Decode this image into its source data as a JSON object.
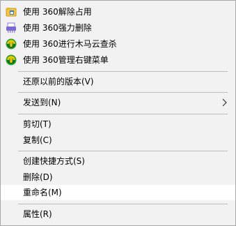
{
  "context_menu": {
    "items": [
      {
        "label": "使用 360解除占用",
        "icon": "folder-unlock-icon"
      },
      {
        "label": "使用 360强力删除",
        "icon": "shredder-icon"
      },
      {
        "label": "使用 360进行木马云查杀",
        "icon": "360-security-icon"
      },
      {
        "label": "使用 360管理右键菜单",
        "icon": "360-security-icon"
      },
      {
        "label": "还原以前的版本(V)"
      },
      {
        "label": "发送到(N)",
        "icon": "chevron-right-icon"
      },
      {
        "label": "剪切(T)"
      },
      {
        "label": "复制(C)"
      },
      {
        "label": "创建快捷方式(S)"
      },
      {
        "label": "删除(D)"
      },
      {
        "label": "重命名(M)",
        "state": "highlighted"
      },
      {
        "label": "属性(R)"
      }
    ]
  },
  "colors": {
    "menu_background": "#f2f2f2",
    "highlight_background": "#ffffff",
    "separator": "#bdbdbd",
    "border": "#a8a8a8",
    "icon_360_green": "#2aa12e",
    "icon_360_yellow": "#f5c400"
  }
}
